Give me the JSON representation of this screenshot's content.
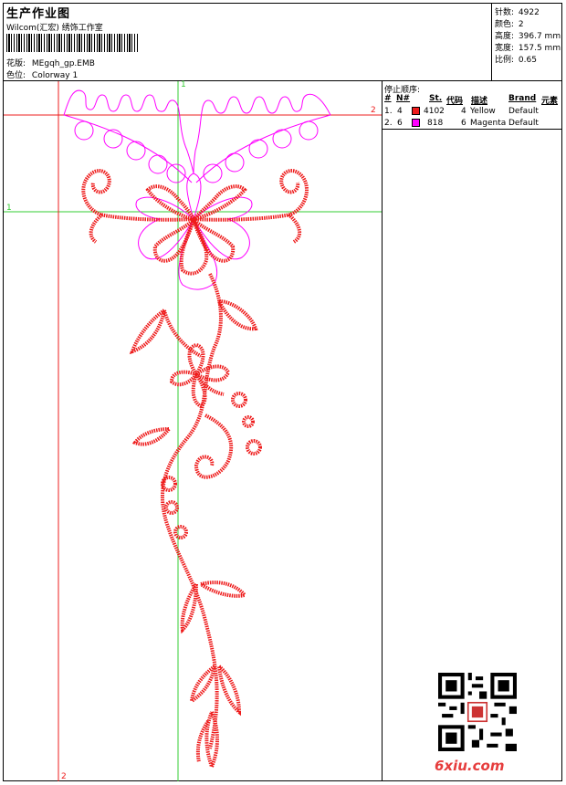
{
  "header": {
    "title": "生产作业图",
    "studio": "Wilcom(汇宏) 绣饰工作室",
    "design_label": "花版:",
    "design_value": "MEgqh_gp.EMB",
    "colorway_label": "色位:",
    "colorway_value": "Colorway 1"
  },
  "stats": [
    {
      "label": "针数:",
      "value": "4922"
    },
    {
      "label": "颜色:",
      "value": "2"
    },
    {
      "label": "高度:",
      "value": "396.7 mm"
    },
    {
      "label": "宽度:",
      "value": "157.5 mm"
    },
    {
      "label": "比例:",
      "value": "0.65"
    }
  ],
  "stop_sequence": {
    "title": "停止顺序:",
    "columns": [
      "#",
      "N#",
      "St.",
      "代码",
      "描述",
      "Brand",
      "元素"
    ],
    "rows": [
      {
        "idx": "1.",
        "n": "4",
        "color": "#ee1c1c",
        "st": "4102",
        "code": "4",
        "desc": "Yellow",
        "brand": "Default"
      },
      {
        "idx": "2.",
        "n": "6",
        "color": "#ff00ff",
        "st": "818",
        "code": "6",
        "desc": "Magenta",
        "brand": "Default"
      }
    ]
  },
  "guides": {
    "h1_label": "1",
    "h2_label": "2",
    "v1_label": "1",
    "v2_label": "2",
    "h1_color": "#33cc33",
    "h2_color": "#ee1c1c",
    "v1_color": "#33cc33",
    "v2_color": "#ee1c1c"
  },
  "watermark": "6xiu.com"
}
